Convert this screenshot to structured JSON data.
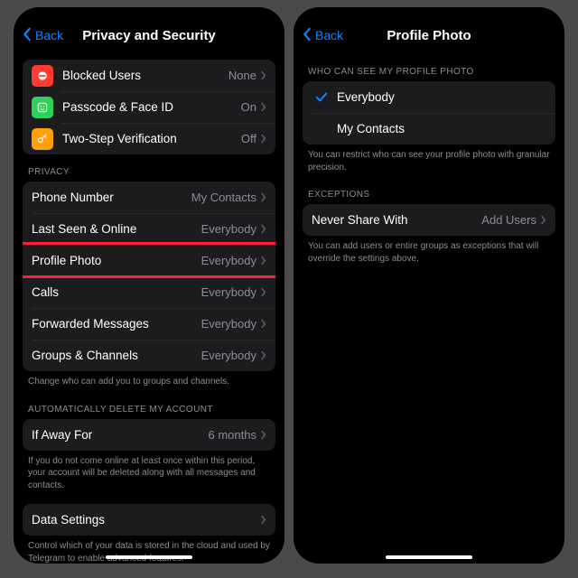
{
  "left": {
    "back": "Back",
    "title": "Privacy and Security",
    "top_rows": [
      {
        "label": "Blocked Users",
        "value": "None",
        "icon_bg": "#ff3b30",
        "icon": "blocked"
      },
      {
        "label": "Passcode & Face ID",
        "value": "On",
        "icon_bg": "#30d158",
        "icon": "faceid"
      },
      {
        "label": "Two-Step Verification",
        "value": "Off",
        "icon_bg": "#ff9f0a",
        "icon": "key"
      }
    ],
    "privacy_header": "PRIVACY",
    "privacy_rows": [
      {
        "label": "Phone Number",
        "value": "My Contacts"
      },
      {
        "label": "Last Seen & Online",
        "value": "Everybody"
      },
      {
        "label": "Profile Photo",
        "value": "Everybody"
      },
      {
        "label": "Calls",
        "value": "Everybody"
      },
      {
        "label": "Forwarded Messages",
        "value": "Everybody"
      },
      {
        "label": "Groups & Channels",
        "value": "Everybody"
      }
    ],
    "privacy_footer": "Change who can add you to groups and channels.",
    "auto_header": "AUTOMATICALLY DELETE MY ACCOUNT",
    "auto_row": {
      "label": "If Away For",
      "value": "6 months"
    },
    "auto_footer": "If you do not come online at least once within this period, your account will be deleted along with all messages and contacts.",
    "data_row": {
      "label": "Data Settings"
    },
    "data_footer": "Control which of your data is stored in the cloud and used by Telegram to enable advanced features."
  },
  "right": {
    "back": "Back",
    "title": "Profile Photo",
    "who_header": "WHO CAN SEE MY PROFILE PHOTO",
    "who_rows": [
      {
        "label": "Everybody",
        "checked": true
      },
      {
        "label": "My Contacts",
        "checked": false
      }
    ],
    "who_footer": "You can restrict who can see your profile photo with granular precision.",
    "exc_header": "EXCEPTIONS",
    "exc_row": {
      "label": "Never Share With",
      "value": "Add Users"
    },
    "exc_footer": "You can add users or entire groups as exceptions that will override the settings above."
  }
}
